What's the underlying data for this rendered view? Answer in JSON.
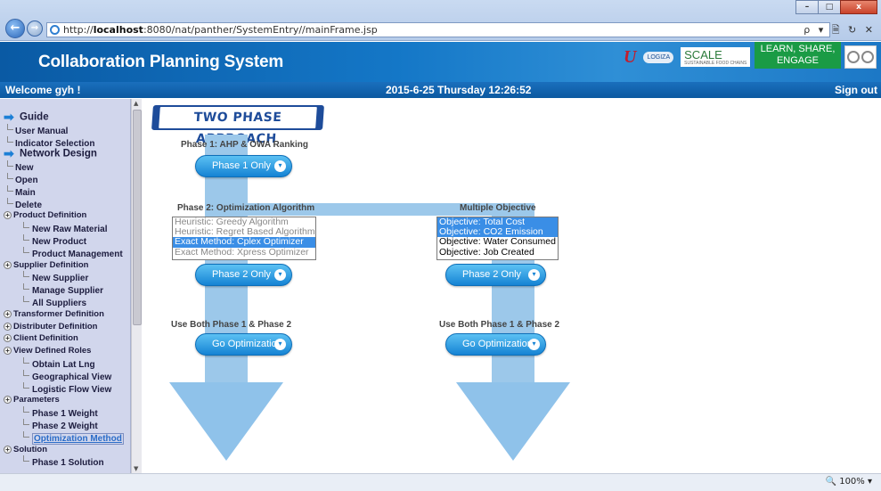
{
  "browser": {
    "url_prefix": "http://",
    "url_host": "localhost",
    "url_rest": ":8080/nat/panther/SystemEntry//mainFrame.jsp",
    "tools": "ρ ▾ 🗎 ↻ ✕",
    "window_controls": [
      "–",
      "□",
      "x"
    ],
    "zoom_label": "100%"
  },
  "header": {
    "title": "Collaboration Planning System",
    "logo_text_a": "U",
    "logo_text_b": "LOGIZA",
    "logo_scale": "SCALE",
    "logo_scale_sub": "SUSTAINABLE FOOD CHAINS",
    "learn_line1": "LEARN, SHARE,",
    "learn_line2": "ENGAGE"
  },
  "statusbar": {
    "welcome": "Welcome gyh !",
    "datetime": "2015-6-25 Thursday 12:26:52",
    "signout": "Sign out"
  },
  "sidebar": {
    "items": [
      {
        "level": "top",
        "label": "Guide"
      },
      {
        "level": "l1",
        "label": "User Manual"
      },
      {
        "level": "l1",
        "label": "Indicator Selection"
      },
      {
        "level": "top",
        "label": "Network Design"
      },
      {
        "level": "l1",
        "label": "New"
      },
      {
        "level": "l1",
        "label": "Open"
      },
      {
        "level": "l1",
        "label": "Main"
      },
      {
        "level": "l1",
        "label": "Delete"
      },
      {
        "level": "l0",
        "label": "Product Definition"
      },
      {
        "level": "l2",
        "label": "New Raw Material"
      },
      {
        "level": "l2",
        "label": "New Product"
      },
      {
        "level": "l2",
        "label": "Product Management"
      },
      {
        "level": "l0",
        "label": "Supplier Definition"
      },
      {
        "level": "l2",
        "label": "New Supplier"
      },
      {
        "level": "l2",
        "label": "Manage Supplier"
      },
      {
        "level": "l2",
        "label": "All Suppliers"
      },
      {
        "level": "l0",
        "label": "Transformer Definition"
      },
      {
        "level": "l0",
        "label": "Distributer Definition"
      },
      {
        "level": "l0",
        "label": "Client Definition"
      },
      {
        "level": "l0",
        "label": "View Defined Roles"
      },
      {
        "level": "l2",
        "label": "Obtain Lat Lng"
      },
      {
        "level": "l2",
        "label": "Geographical View"
      },
      {
        "level": "l2",
        "label": "Logistic Flow View"
      },
      {
        "level": "l0",
        "label": "Parameters"
      },
      {
        "level": "l2",
        "label": "Phase 1 Weight"
      },
      {
        "level": "l2",
        "label": "Phase 2 Weight"
      },
      {
        "level": "l2sel",
        "label": "Optimization Method"
      },
      {
        "level": "l0",
        "label": "Solution"
      },
      {
        "level": "l2",
        "label": "Phase 1 Solution"
      }
    ]
  },
  "main": {
    "banner": "TWO PHASE APPROACH",
    "phase1_label": "Phase 1: AHP & OWA Ranking",
    "phase1_button": "Phase 1 Only",
    "phase2_label": "Phase 2: Optimization Algorithm",
    "multi_label": "Multiple Objective",
    "algorithms": [
      {
        "label": "Heuristic: Greedy Algorithm",
        "state": "dim"
      },
      {
        "label": "Heuristic: Regret Based Algorithm",
        "state": "dim"
      },
      {
        "label": "Exact Method: Cplex Optimizer",
        "state": "selected"
      },
      {
        "label": "Exact Method: Xpress Optimizer",
        "state": "dim"
      }
    ],
    "objectives": [
      {
        "label": "Objective: Total Cost",
        "state": "selected"
      },
      {
        "label": "Objective: CO2 Emission",
        "state": "selected"
      },
      {
        "label": "Objective: Water Consumed",
        "state": "on"
      },
      {
        "label": "Objective: Job Created",
        "state": "on"
      }
    ],
    "phase2_button_left": "Phase 2 Only",
    "phase2_button_right": "Phase 2 Only",
    "both_label_left": "Use Both Phase 1 & Phase 2",
    "both_label_right": "Use Both Phase 1 & Phase 2",
    "go_button_left": "Go Optimization",
    "go_button_right": "Go Optimization"
  },
  "colors": {
    "header_blue": "#1477c7",
    "sidebar_bg": "#d1d6ec",
    "arrow_blue": "#9cc8ea",
    "button_blue": "#1583d4",
    "selection_blue": "#3a8ee6"
  }
}
